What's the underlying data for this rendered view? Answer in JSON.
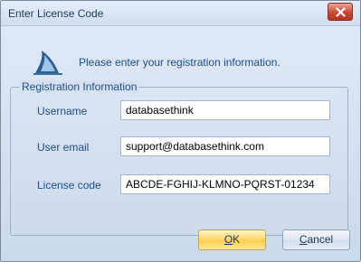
{
  "window": {
    "title": "Enter License Code"
  },
  "header": {
    "message": "Please enter your registration information."
  },
  "group": {
    "legend": "Registration Information",
    "fields": [
      {
        "label": "Username",
        "value": "databasethink"
      },
      {
        "label": "User email",
        "value": "support@databasethink.com"
      },
      {
        "label": "License code",
        "value": "ABCDE-FGHIJ-KLMNO-PQRST-01234"
      }
    ]
  },
  "buttons": {
    "ok_mnemonic": "O",
    "ok_rest": "K",
    "cancel_mnemonic": "C",
    "cancel_rest": "ancel"
  },
  "icons": {
    "app_icon": "shark-fin-icon",
    "close_icon": "close-icon"
  },
  "colors": {
    "accent_text": "#1e4e8c",
    "close_button": "#c74a3a",
    "ok_button": "#ffd768"
  }
}
